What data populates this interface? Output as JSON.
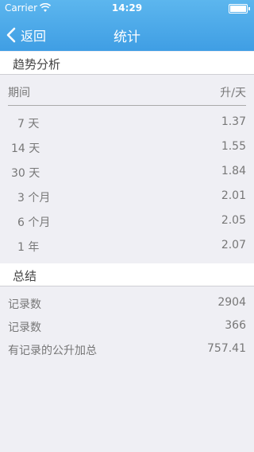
{
  "status": {
    "carrier": "Carrier",
    "time": "14:29"
  },
  "nav": {
    "back_label": "返回",
    "title": "统计"
  },
  "trend": {
    "section_title": "趋势分析",
    "col_period": "期间",
    "col_unit": "升/天",
    "rows": [
      {
        "period": "7 天",
        "value": "1.37"
      },
      {
        "period": "14 天",
        "value": "1.55"
      },
      {
        "period": "30 天",
        "value": "1.84"
      },
      {
        "period": "3 个月",
        "value": "2.01"
      },
      {
        "period": "6 个月",
        "value": "2.05"
      },
      {
        "period": "1 年",
        "value": "2.07"
      }
    ]
  },
  "summary": {
    "section_title": "总结",
    "rows": [
      {
        "label": "记录数",
        "value": "2904"
      },
      {
        "label": "记录数",
        "value": "366"
      },
      {
        "label": "有记录的公升加总",
        "value": "757.41"
      }
    ]
  }
}
